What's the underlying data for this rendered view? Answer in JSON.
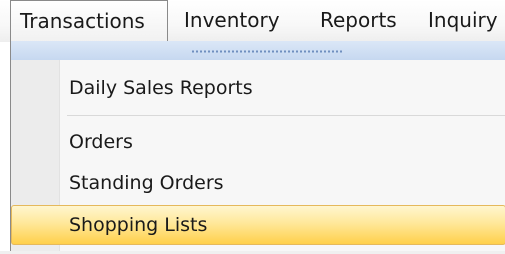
{
  "menubar": {
    "items": [
      {
        "label": "Transactions",
        "state": "open"
      },
      {
        "label": "Inventory"
      },
      {
        "label": "Reports"
      },
      {
        "label": "Inquiry"
      }
    ]
  },
  "dropdown": {
    "items": [
      {
        "label": "Daily Sales Reports"
      },
      {
        "label": "Orders"
      },
      {
        "label": "Standing Orders"
      },
      {
        "label": "Shopping Lists",
        "state": "highlighted"
      }
    ]
  },
  "colors": {
    "highlight": "#ffd04b",
    "grip_bar": "#c6d8f0"
  }
}
